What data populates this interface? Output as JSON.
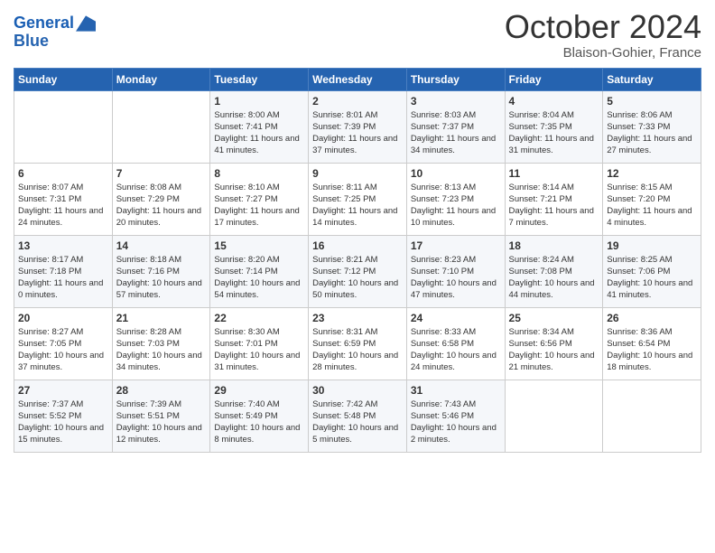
{
  "header": {
    "logo_line1": "General",
    "logo_line2": "Blue",
    "month": "October 2024",
    "location": "Blaison-Gohier, France"
  },
  "weekdays": [
    "Sunday",
    "Monday",
    "Tuesday",
    "Wednesday",
    "Thursday",
    "Friday",
    "Saturday"
  ],
  "weeks": [
    [
      {
        "day": "",
        "sunrise": "",
        "sunset": "",
        "daylight": ""
      },
      {
        "day": "",
        "sunrise": "",
        "sunset": "",
        "daylight": ""
      },
      {
        "day": "1",
        "sunrise": "Sunrise: 8:00 AM",
        "sunset": "Sunset: 7:41 PM",
        "daylight": "Daylight: 11 hours and 41 minutes."
      },
      {
        "day": "2",
        "sunrise": "Sunrise: 8:01 AM",
        "sunset": "Sunset: 7:39 PM",
        "daylight": "Daylight: 11 hours and 37 minutes."
      },
      {
        "day": "3",
        "sunrise": "Sunrise: 8:03 AM",
        "sunset": "Sunset: 7:37 PM",
        "daylight": "Daylight: 11 hours and 34 minutes."
      },
      {
        "day": "4",
        "sunrise": "Sunrise: 8:04 AM",
        "sunset": "Sunset: 7:35 PM",
        "daylight": "Daylight: 11 hours and 31 minutes."
      },
      {
        "day": "5",
        "sunrise": "Sunrise: 8:06 AM",
        "sunset": "Sunset: 7:33 PM",
        "daylight": "Daylight: 11 hours and 27 minutes."
      }
    ],
    [
      {
        "day": "6",
        "sunrise": "Sunrise: 8:07 AM",
        "sunset": "Sunset: 7:31 PM",
        "daylight": "Daylight: 11 hours and 24 minutes."
      },
      {
        "day": "7",
        "sunrise": "Sunrise: 8:08 AM",
        "sunset": "Sunset: 7:29 PM",
        "daylight": "Daylight: 11 hours and 20 minutes."
      },
      {
        "day": "8",
        "sunrise": "Sunrise: 8:10 AM",
        "sunset": "Sunset: 7:27 PM",
        "daylight": "Daylight: 11 hours and 17 minutes."
      },
      {
        "day": "9",
        "sunrise": "Sunrise: 8:11 AM",
        "sunset": "Sunset: 7:25 PM",
        "daylight": "Daylight: 11 hours and 14 minutes."
      },
      {
        "day": "10",
        "sunrise": "Sunrise: 8:13 AM",
        "sunset": "Sunset: 7:23 PM",
        "daylight": "Daylight: 11 hours and 10 minutes."
      },
      {
        "day": "11",
        "sunrise": "Sunrise: 8:14 AM",
        "sunset": "Sunset: 7:21 PM",
        "daylight": "Daylight: 11 hours and 7 minutes."
      },
      {
        "day": "12",
        "sunrise": "Sunrise: 8:15 AM",
        "sunset": "Sunset: 7:20 PM",
        "daylight": "Daylight: 11 hours and 4 minutes."
      }
    ],
    [
      {
        "day": "13",
        "sunrise": "Sunrise: 8:17 AM",
        "sunset": "Sunset: 7:18 PM",
        "daylight": "Daylight: 11 hours and 0 minutes."
      },
      {
        "day": "14",
        "sunrise": "Sunrise: 8:18 AM",
        "sunset": "Sunset: 7:16 PM",
        "daylight": "Daylight: 10 hours and 57 minutes."
      },
      {
        "day": "15",
        "sunrise": "Sunrise: 8:20 AM",
        "sunset": "Sunset: 7:14 PM",
        "daylight": "Daylight: 10 hours and 54 minutes."
      },
      {
        "day": "16",
        "sunrise": "Sunrise: 8:21 AM",
        "sunset": "Sunset: 7:12 PM",
        "daylight": "Daylight: 10 hours and 50 minutes."
      },
      {
        "day": "17",
        "sunrise": "Sunrise: 8:23 AM",
        "sunset": "Sunset: 7:10 PM",
        "daylight": "Daylight: 10 hours and 47 minutes."
      },
      {
        "day": "18",
        "sunrise": "Sunrise: 8:24 AM",
        "sunset": "Sunset: 7:08 PM",
        "daylight": "Daylight: 10 hours and 44 minutes."
      },
      {
        "day": "19",
        "sunrise": "Sunrise: 8:25 AM",
        "sunset": "Sunset: 7:06 PM",
        "daylight": "Daylight: 10 hours and 41 minutes."
      }
    ],
    [
      {
        "day": "20",
        "sunrise": "Sunrise: 8:27 AM",
        "sunset": "Sunset: 7:05 PM",
        "daylight": "Daylight: 10 hours and 37 minutes."
      },
      {
        "day": "21",
        "sunrise": "Sunrise: 8:28 AM",
        "sunset": "Sunset: 7:03 PM",
        "daylight": "Daylight: 10 hours and 34 minutes."
      },
      {
        "day": "22",
        "sunrise": "Sunrise: 8:30 AM",
        "sunset": "Sunset: 7:01 PM",
        "daylight": "Daylight: 10 hours and 31 minutes."
      },
      {
        "day": "23",
        "sunrise": "Sunrise: 8:31 AM",
        "sunset": "Sunset: 6:59 PM",
        "daylight": "Daylight: 10 hours and 28 minutes."
      },
      {
        "day": "24",
        "sunrise": "Sunrise: 8:33 AM",
        "sunset": "Sunset: 6:58 PM",
        "daylight": "Daylight: 10 hours and 24 minutes."
      },
      {
        "day": "25",
        "sunrise": "Sunrise: 8:34 AM",
        "sunset": "Sunset: 6:56 PM",
        "daylight": "Daylight: 10 hours and 21 minutes."
      },
      {
        "day": "26",
        "sunrise": "Sunrise: 8:36 AM",
        "sunset": "Sunset: 6:54 PM",
        "daylight": "Daylight: 10 hours and 18 minutes."
      }
    ],
    [
      {
        "day": "27",
        "sunrise": "Sunrise: 7:37 AM",
        "sunset": "Sunset: 5:52 PM",
        "daylight": "Daylight: 10 hours and 15 minutes."
      },
      {
        "day": "28",
        "sunrise": "Sunrise: 7:39 AM",
        "sunset": "Sunset: 5:51 PM",
        "daylight": "Daylight: 10 hours and 12 minutes."
      },
      {
        "day": "29",
        "sunrise": "Sunrise: 7:40 AM",
        "sunset": "Sunset: 5:49 PM",
        "daylight": "Daylight: 10 hours and 8 minutes."
      },
      {
        "day": "30",
        "sunrise": "Sunrise: 7:42 AM",
        "sunset": "Sunset: 5:48 PM",
        "daylight": "Daylight: 10 hours and 5 minutes."
      },
      {
        "day": "31",
        "sunrise": "Sunrise: 7:43 AM",
        "sunset": "Sunset: 5:46 PM",
        "daylight": "Daylight: 10 hours and 2 minutes."
      },
      {
        "day": "",
        "sunrise": "",
        "sunset": "",
        "daylight": ""
      },
      {
        "day": "",
        "sunrise": "",
        "sunset": "",
        "daylight": ""
      }
    ]
  ]
}
